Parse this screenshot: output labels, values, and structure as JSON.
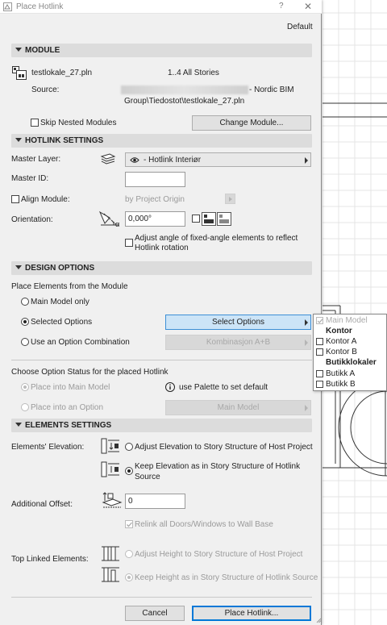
{
  "dialog": {
    "title": "Place Hotlink",
    "help_label": "?",
    "close_label": "✕",
    "preset": "Default"
  },
  "module": {
    "header": "MODULE",
    "file_name": "testlokale_27.pln",
    "stories": "1..4 All Stories",
    "source_label": "Source:",
    "source_suffix": "- Nordic BIM",
    "source_line2": "Group\\Tiedostot\\testlokale_27.pln",
    "skip_nested_label": "Skip Nested Modules",
    "skip_nested_checked": false,
    "change_module_label": "Change Module..."
  },
  "hotlink_settings": {
    "header": "HOTLINK SETTINGS",
    "master_layer_label": "Master Layer:",
    "master_layer_value": "- Hotlink Interiør",
    "master_id_label": "Master ID:",
    "master_id_value": "",
    "align_module_label": "Align Module:",
    "align_module_checked": false,
    "align_value": "by Project Origin",
    "orientation_label": "Orientation:",
    "orientation_value": "0,000°",
    "alpha_symbol": "α",
    "adjust_angle_line1": "Adjust angle of fixed-angle elements to reflect",
    "adjust_angle_line2": "Hotlink rotation",
    "adjust_angle_checked": false
  },
  "design_options": {
    "header": "DESIGN OPTIONS",
    "place_from_label": "Place Elements from the Module",
    "radio_main_model_only": "Main Model only",
    "radio_selected_options": "Selected Options",
    "radio_option_combination": "Use an Option Combination",
    "selected_radio": "Selected Options",
    "select_options_button": "Select Options",
    "combination_value": "Kombinasjon A+B",
    "choose_status_label": "Choose Option Status for the placed Hotlink",
    "place_into_main_model": "Place into Main Model",
    "place_into_option": "Place into an Option",
    "info_icon_label": "i",
    "use_palette_text": "use Palette to set default",
    "main_model_value": "Main Model"
  },
  "options_popup": {
    "items": [
      {
        "label": "Main Model",
        "type": "option",
        "checked": true,
        "disabled": true
      },
      {
        "label": "Kontor",
        "type": "header"
      },
      {
        "label": "Kontor A",
        "type": "option",
        "checked": false
      },
      {
        "label": "Kontor B",
        "type": "option",
        "checked": false
      },
      {
        "label": "Butikklokaler",
        "type": "header"
      },
      {
        "label": "Butikk A",
        "type": "option",
        "checked": false
      },
      {
        "label": "Butikk B",
        "type": "option",
        "checked": false
      }
    ]
  },
  "elements_settings": {
    "header": "ELEMENTS SETTINGS",
    "elevation_label": "Elements' Elevation:",
    "adjust_elevation": "Adjust Elevation to Story Structure of Host Project",
    "keep_elevation_line1": "Keep Elevation as in Story Structure of Hotlink",
    "keep_elevation_line2": "Source",
    "selected_elevation": "keep",
    "additional_offset_label": "Additional Offset:",
    "additional_offset_value": "0",
    "relink_label": "Relink all Doors/Windows to Wall Base",
    "relink_checked": true,
    "top_linked_label": "Top Linked Elements:",
    "adjust_height": "Adjust Height to Story Structure of Host Project",
    "keep_height": "Keep Height as in Story Structure of Hotlink Source"
  },
  "footer": {
    "cancel_label": "Cancel",
    "place_label": "Place Hotlink..."
  },
  "colors": {
    "dialog_bg": "#f0f0f0",
    "section_bg": "#dcdcdc",
    "accent_blue": "#0078d7",
    "select_options_bg": "#cce4f7"
  }
}
